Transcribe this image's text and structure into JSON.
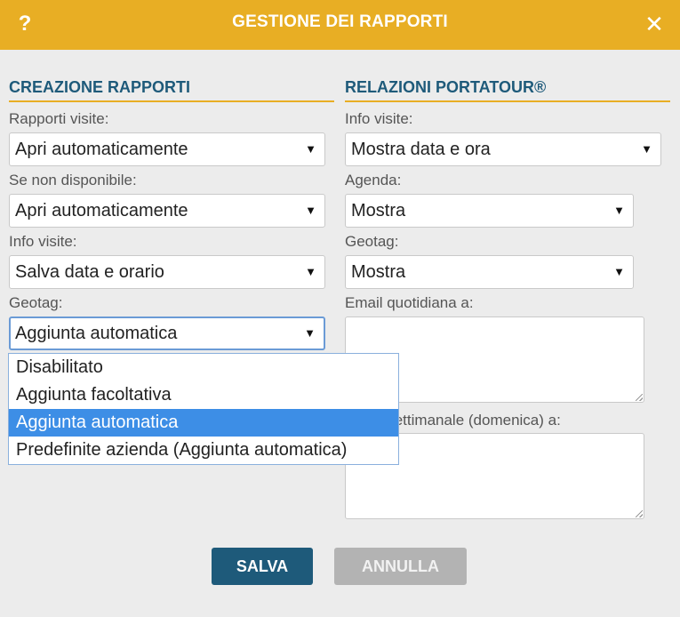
{
  "header": {
    "help_icon": "?",
    "title": "GESTIONE DEI RAPPORTI",
    "close_icon": "✕"
  },
  "left": {
    "title": "CREAZIONE RAPPORTI",
    "fields": [
      {
        "label": "Rapporti visite:",
        "value": "Apri automaticamente"
      },
      {
        "label": "Se non disponibile:",
        "value": "Apri automaticamente"
      },
      {
        "label": "Info visite:",
        "value": "Salva data e orario"
      },
      {
        "label": "Geotag:",
        "value": "Aggiunta automatica"
      }
    ],
    "geotag_options": [
      "Disabilitato",
      "Aggiunta facoltativa",
      "Aggiunta automatica",
      "Predefinite azienda (Aggiunta automatica)"
    ],
    "geotag_selected_index": 2
  },
  "right": {
    "title": "RELAZIONI PORTATOUR®",
    "fields": [
      {
        "label": "Info visite:",
        "value": "Mostra data e ora"
      },
      {
        "label": "Agenda:",
        "value": "Mostra"
      },
      {
        "label": "Geotag:",
        "value": "Mostra"
      }
    ],
    "daily_email_label": "Email quotidiana a:",
    "daily_email_value": "",
    "weekly_email_label": "Email settimanale (domenica) a:",
    "weekly_email_value": ""
  },
  "buttons": {
    "save": "SALVA",
    "cancel": "ANNULLA"
  },
  "dropdown_arrow": "▼",
  "colors": {
    "header_bg": "#e8ae24",
    "title_blue": "#1e5a7a",
    "selected_option": "#3d8ee6",
    "cancel_bg": "#b3b3b3"
  }
}
